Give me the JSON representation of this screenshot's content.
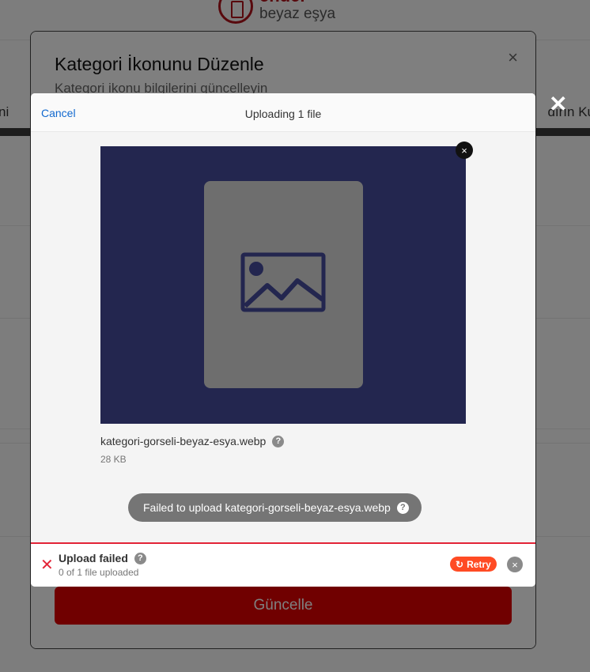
{
  "page": {
    "brand_name": "ender",
    "brand_sub": "beyaz eşya",
    "nav_left": "ni",
    "nav_right": "dırın Ku"
  },
  "edit_modal": {
    "title": "Kategori İkonunu Düzenle",
    "subtitle": "Kategori ikonu bilgilerini güncelleyin",
    "close_icon": "×",
    "submit_label": "Güncelle"
  },
  "uploader": {
    "close_icon": "✕",
    "cancel_label": "Cancel",
    "title": "Uploading 1 file",
    "file": {
      "name": "kategori-gorseli-beyaz-esya.webp",
      "size": "28 KB",
      "icon": "image-icon"
    },
    "remove_icon": "×",
    "error_toast": "Failed to upload kategori-gorseli-beyaz-esya.webp",
    "help_icon": "?",
    "status": {
      "icon": "✕",
      "title": "Upload failed",
      "subtitle": "0 of 1 file uploaded",
      "retry_icon": "↻",
      "retry_label": "Retry",
      "close_icon": "×"
    }
  },
  "colors": {
    "accent_red": "#e32437",
    "retry_orange": "#ff4b24",
    "preview_bg": "#23264f",
    "link_blue": "#1269cf"
  }
}
